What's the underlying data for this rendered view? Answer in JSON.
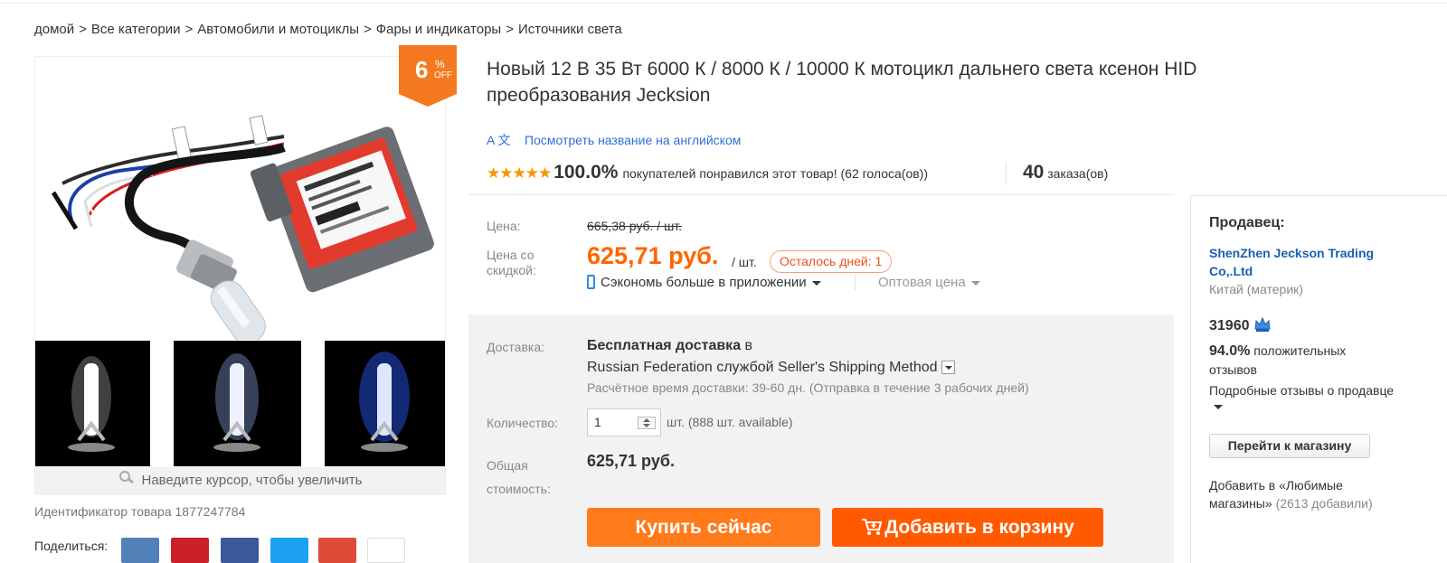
{
  "breadcrumb": {
    "items": [
      "домой",
      "Все категории",
      "Автомобили и мотоциклы",
      "Фары и индикаторы",
      "Источники света"
    ],
    "separator": ">"
  },
  "gallery": {
    "zoom_hint": "Наведите курсор, чтобы увеличить",
    "discount": {
      "number": "6",
      "percent": "%",
      "off": "OFF"
    },
    "product_id": "Идентификатор товара 1877247784",
    "share_label": "Поделиться:"
  },
  "product": {
    "title": "Новый 12 В 35 Вт 6000 К / 8000 К / 10000 К мотоцикл дальнего света ксенон HID преобразования Jecksion",
    "translate_icon": "A 文",
    "translate_link": "Посмотреть название на английском",
    "rating_pct": "100.0%",
    "rating_text": "покупателей понравился этот товар! (62 голоса(ов))",
    "orders_count": "40",
    "orders_label": "заказа(ов)"
  },
  "price": {
    "price_label": "Цена:",
    "old_price": "665,38 руб. / шт.",
    "discount_label_line1": "Цена со",
    "discount_label_line2": "скидкой:",
    "new_price": "625,71 руб.",
    "per_unit": "/ шт.",
    "days_left": "Осталось дней: 1",
    "app_save": "Сэкономь больше в приложении",
    "wholesale": "Оптовая цена"
  },
  "shipping": {
    "label": "Доставка:",
    "free": "Бесплатная доставка",
    "to": "в",
    "method": "Russian Federation службой Seller's Shipping Method",
    "time": "Расчётное время доставки: 39-60 дн. (Отправка в течение 3 рабочих дней)",
    "qty_label": "Количество:",
    "qty_value": "1",
    "available": "шт. (888 шт. available)",
    "total_label_line1": "Общая",
    "total_label_line2": "стоимость:",
    "total": "625,71 руб."
  },
  "actions": {
    "buy_now": "Купить сейчас",
    "add_to_cart": "Добавить в корзину"
  },
  "seller": {
    "heading": "Продавец:",
    "name": "ShenZhen Jeckson Trading Co,.Ltd",
    "country": "Китай (материк)",
    "score": "31960",
    "positive_pct": "94.0%",
    "positive_text": "положительных отзывов",
    "detailed_feedback": "Подробные отзывы о продавце",
    "store_button": "Перейти к магазину",
    "favorite_text": "Добавить в «Любимые магазины»",
    "favorite_count": "(2613 добавили)"
  },
  "colors": {
    "accent_orange": "#ff6600",
    "button_buy": "#ff7a1a",
    "button_cart": "#ff5a00",
    "link_blue": "#2e6fd6",
    "star": "#f39800"
  }
}
